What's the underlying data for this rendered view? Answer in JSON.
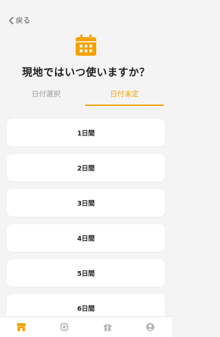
{
  "header": {
    "back_label": "戻る",
    "title": "現地ではいつ使いますか？"
  },
  "tabs": [
    {
      "label": "日付選択",
      "active": false
    },
    {
      "label": "日付未定",
      "active": true
    }
  ],
  "options": [
    {
      "label": "1日間"
    },
    {
      "label": "2日間"
    },
    {
      "label": "3日間"
    },
    {
      "label": "4日間"
    },
    {
      "label": "5日間"
    },
    {
      "label": "6日間"
    }
  ],
  "bottom_nav": [
    {
      "icon": "shop-icon",
      "active": true
    },
    {
      "icon": "sim-chip-icon",
      "active": false
    },
    {
      "icon": "gift-icon",
      "active": false
    },
    {
      "icon": "account-icon",
      "active": false
    }
  ],
  "colors": {
    "accent": "#f5a200",
    "inactive_icon": "#b5b5b5"
  }
}
